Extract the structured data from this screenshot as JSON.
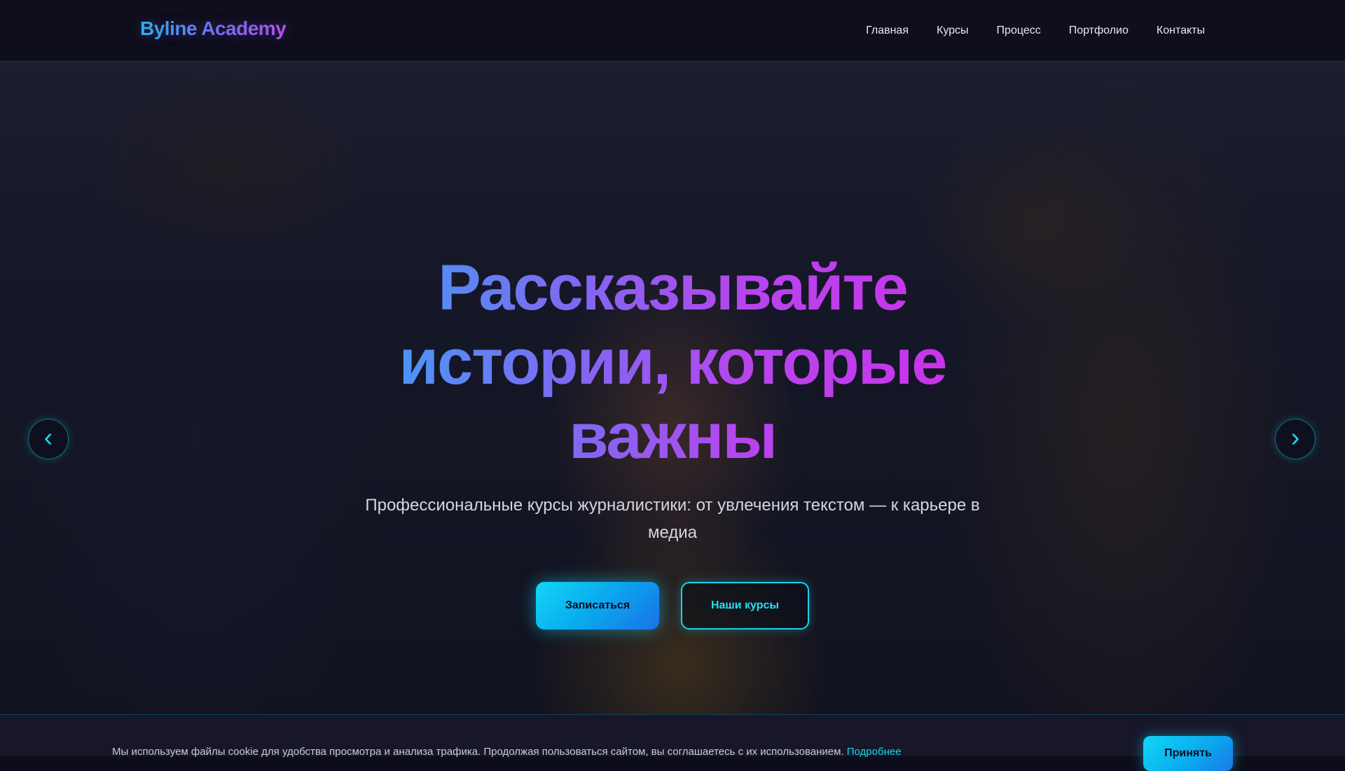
{
  "header": {
    "logo": "Byline Academy",
    "nav": [
      "Главная",
      "Курсы",
      "Процесс",
      "Портфолио",
      "Контакты"
    ]
  },
  "hero": {
    "title": "Рассказывайте истории, которые важны",
    "subtitle": "Профессиональные курсы журналистики: от увлечения текстом — к карьере в медиа",
    "primary_button": "Записаться",
    "secondary_button": "Наши курсы",
    "prev_arrow": "‹",
    "next_arrow": "›"
  },
  "cookie": {
    "text": "Мы используем файлы cookie для удобства просмотра и анализа трафика. Продолжая пользоваться сайтом, вы соглашаетесь с их использованием.",
    "link": "Подробнее",
    "accept": "Принять"
  },
  "colors": {
    "background": "#0d0c1a",
    "accent_cyan": "#19d3ea",
    "accent_magenta": "#d12ce8",
    "accent_blue": "#35a8f5"
  }
}
